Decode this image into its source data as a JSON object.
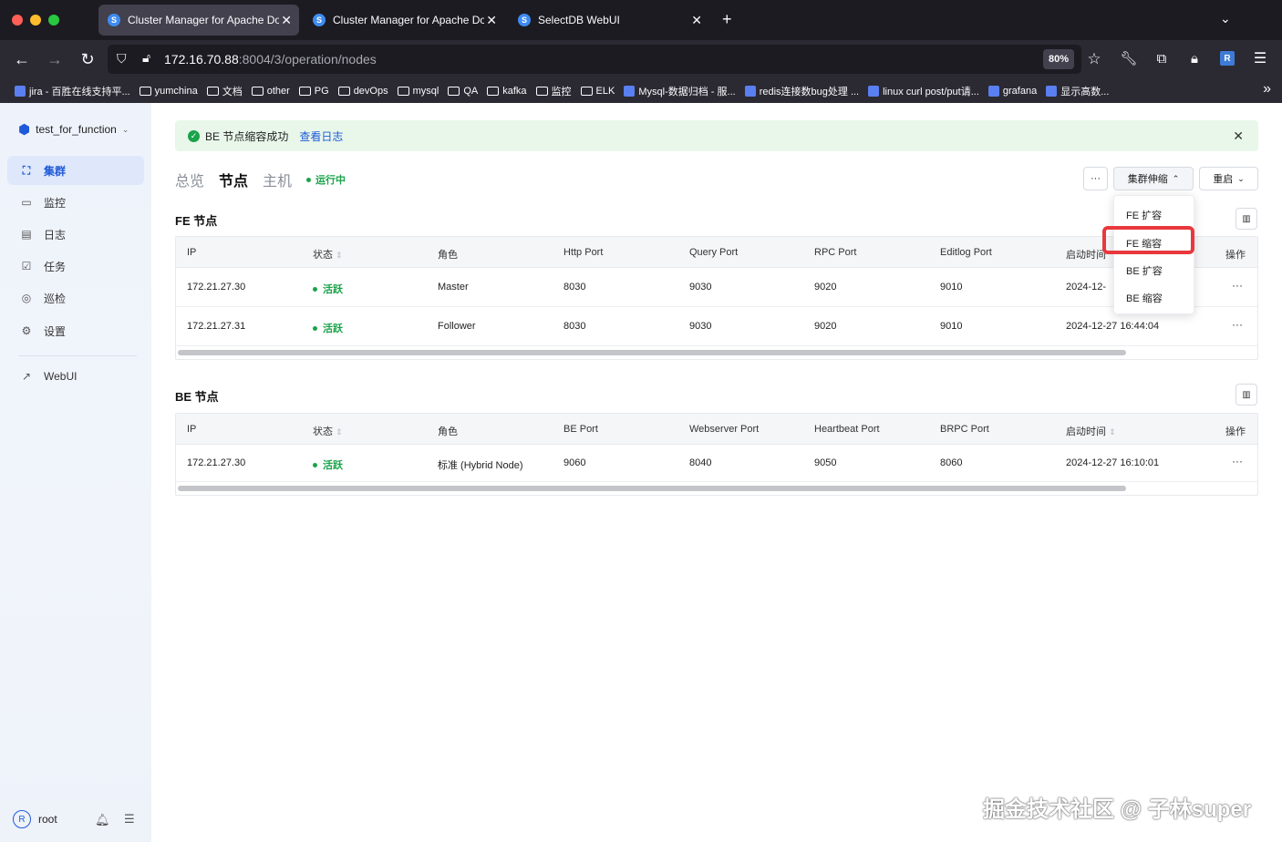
{
  "browser": {
    "tabs": [
      {
        "title": "Cluster Manager for Apache Doris",
        "active": true
      },
      {
        "title": "Cluster Manager for Apache Doris",
        "active": false
      },
      {
        "title": "SelectDB WebUI",
        "active": false
      }
    ],
    "url_host": "172.16.70.88",
    "url_path": ":8004/3/operation/nodes",
    "zoom": "80%",
    "profile_initial": "R",
    "bookmarks": [
      "jira - 百胜在线支持平...",
      "yumchina",
      "文档",
      "other",
      "PG",
      "devOps",
      "mysql",
      "QA",
      "kafka",
      "监控",
      "ELK",
      "Mysql-数据归档 - 服...",
      "redis连接数bug处理 ...",
      "linux curl post/put请...",
      "grafana",
      "显示高数..."
    ]
  },
  "sidebar": {
    "cluster_name": "test_for_function",
    "items": [
      {
        "label": "集群",
        "icon": "cluster-icon"
      },
      {
        "label": "监控",
        "icon": "monitor-icon"
      },
      {
        "label": "日志",
        "icon": "log-icon"
      },
      {
        "label": "任务",
        "icon": "task-icon"
      },
      {
        "label": "巡检",
        "icon": "inspect-icon"
      },
      {
        "label": "设置",
        "icon": "settings-icon"
      }
    ],
    "webui_label": "WebUI",
    "user": "root",
    "user_initial": "R"
  },
  "alert": {
    "message": "BE 节点缩容成功",
    "link": "查看日志"
  },
  "page_tabs": [
    "总览",
    "节点",
    "主机"
  ],
  "status_label": "运行中",
  "toolbar": {
    "more": "···",
    "scale_label": "集群伸缩",
    "restart_label": "重启"
  },
  "scale_menu": [
    "FE 扩容",
    "FE 缩容",
    "BE 扩容",
    "BE 缩容"
  ],
  "fe": {
    "title": "FE 节点",
    "columns": [
      "IP",
      "状态",
      "角色",
      "Http Port",
      "Query Port",
      "RPC Port",
      "Editlog Port",
      "启动时间",
      "操作"
    ],
    "rows": [
      {
        "ip": "172.21.27.30",
        "status": "活跃",
        "role": "Master",
        "http": "8030",
        "query": "9030",
        "rpc": "9020",
        "editlog": "9010",
        "start": "2024-12-",
        "op": "···"
      },
      {
        "ip": "172.21.27.31",
        "status": "活跃",
        "role": "Follower",
        "http": "8030",
        "query": "9030",
        "rpc": "9020",
        "editlog": "9010",
        "start": "2024-12-27 16:44:04",
        "op": "···"
      }
    ]
  },
  "be": {
    "title": "BE 节点",
    "columns": [
      "IP",
      "状态",
      "角色",
      "BE Port",
      "Webserver Port",
      "Heartbeat Port",
      "BRPC Port",
      "启动时间",
      "操作"
    ],
    "rows": [
      {
        "ip": "172.21.27.30",
        "status": "活跃",
        "role": "标准 (Hybrid Node)",
        "be_port": "9060",
        "webserver": "8040",
        "heartbeat": "9050",
        "brpc": "8060",
        "start": "2024-12-27 16:10:01",
        "op": "···"
      }
    ]
  },
  "watermark": "掘金技术社区 @ 子林super"
}
